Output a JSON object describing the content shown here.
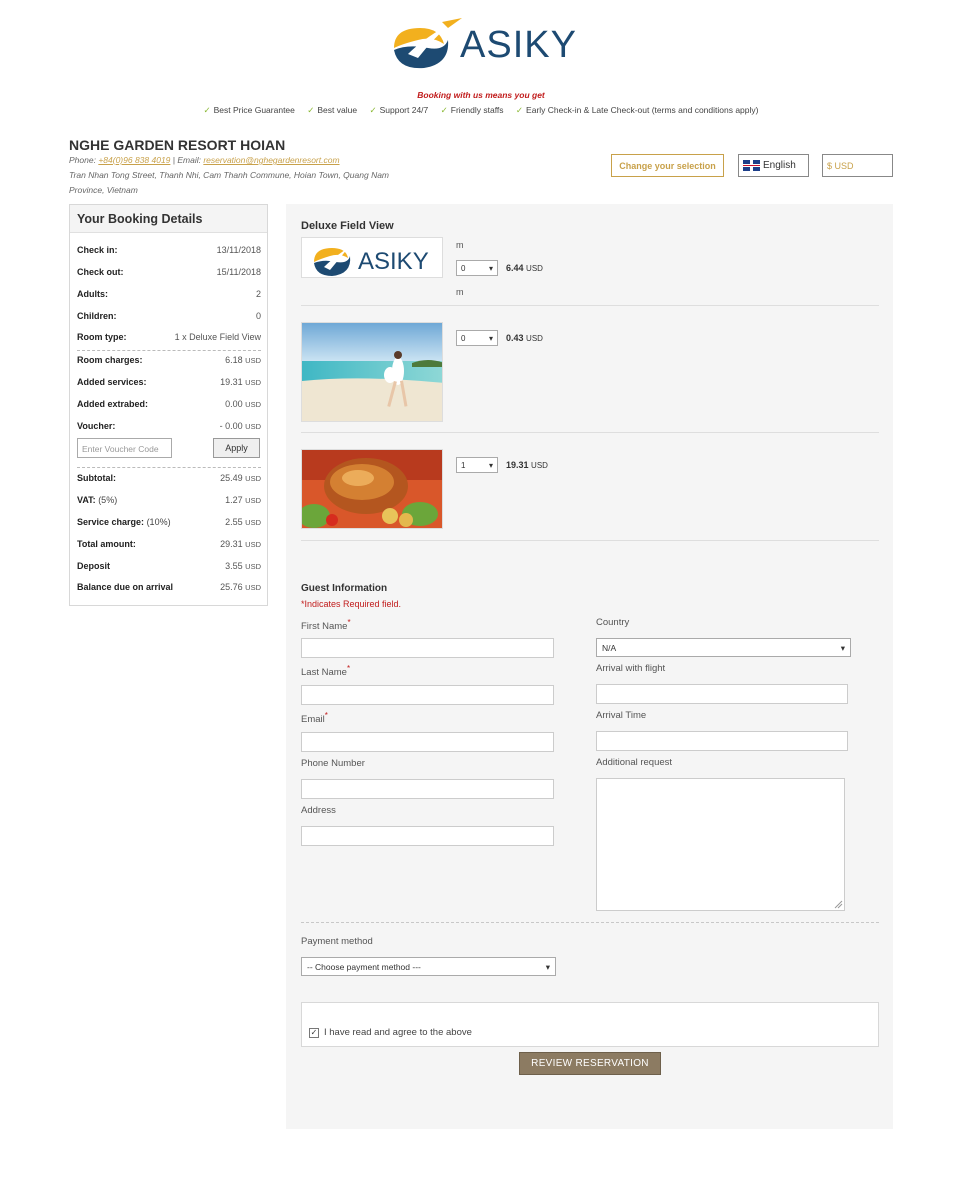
{
  "brand": {
    "logo_text": "ASIKY",
    "accent": "#c8a14a",
    "logo_blue": "#1d4a72",
    "logo_yellow": "#f2b01e"
  },
  "header": {
    "tagline": "Booking with us means you get",
    "benefits": [
      "Best Price Guarantee",
      "Best value",
      "Support 24/7",
      "Friendly staffs",
      "Early Check-in & Late Check-out (terms and conditions apply)"
    ]
  },
  "hotel": {
    "name": "NGHE GARDEN RESORT HOIAN",
    "phone_label": "Phone:",
    "phone": "+84(0)96 838 4019",
    "email_label": "| Email:",
    "email": "reservation@nghegardenresort.com",
    "address_line1": "Tran Nhan Tong Street, Thanh Nhi, Cam Thanh Commune, Hoian Town, Quang Nam",
    "address_line2": "Province, Vietnam"
  },
  "controls": {
    "change_selection": "Change your selection",
    "language": "English",
    "currency": "$ USD"
  },
  "booking": {
    "title": "Your Booking Details",
    "check_in_label": "Check in:",
    "check_in": "13/11/2018",
    "check_out_label": "Check out:",
    "check_out": "15/11/2018",
    "adults_label": "Adults:",
    "adults": "2",
    "children_label": "Children:",
    "children": "0",
    "room_type_label": "Room type:",
    "room_type": "1 x Deluxe Field View",
    "room_charges_label": "Room charges:",
    "room_charges": "6.18",
    "added_services_label": "Added services:",
    "added_services": "19.31",
    "added_extrabed_label": "Added extrabed:",
    "added_extrabed": "0.00",
    "voucher_label": "Voucher:",
    "voucher": "- 0.00",
    "voucher_placeholder": "Enter Voucher Code",
    "apply": "Apply",
    "subtotal_label": "Subtotal:",
    "subtotal": "25.49",
    "vat_label": "VAT:",
    "vat_rate": "(5%)",
    "vat": "1.27",
    "service_label": "Service charge:",
    "service_rate": "(10%)",
    "service": "2.55",
    "total_label": "Total amount:",
    "total": "29.31",
    "deposit_label": "Deposit",
    "deposit": "3.55",
    "balance_label": "Balance due on arrival",
    "balance": "25.76",
    "currency_unit": "USD"
  },
  "room": {
    "title": "Deluxe Field View",
    "items": [
      {
        "qty": "0",
        "price": "6.44",
        "unit": "USD",
        "note_top": "m",
        "note_bottom": "m"
      },
      {
        "qty": "0",
        "price": "0.43",
        "unit": "USD"
      },
      {
        "qty": "1",
        "price": "19.31",
        "unit": "USD"
      }
    ]
  },
  "guest": {
    "title": "Guest Information",
    "required_note": "*Indicates Required field.",
    "first_name": "First Name",
    "last_name": "Last Name",
    "email": "Email",
    "phone": "Phone Number",
    "address": "Address",
    "country": "Country",
    "country_value": "N/A",
    "arrival_flight": "Arrival with flight",
    "arrival_time": "Arrival Time",
    "additional_request": "Additional request",
    "required_mark": "*"
  },
  "payment": {
    "label": "Payment method",
    "placeholder": "-- Choose payment method ---"
  },
  "agree": {
    "text": "I have read and agree to the above",
    "checked": true
  },
  "review_button": "REVIEW RESERVATION"
}
